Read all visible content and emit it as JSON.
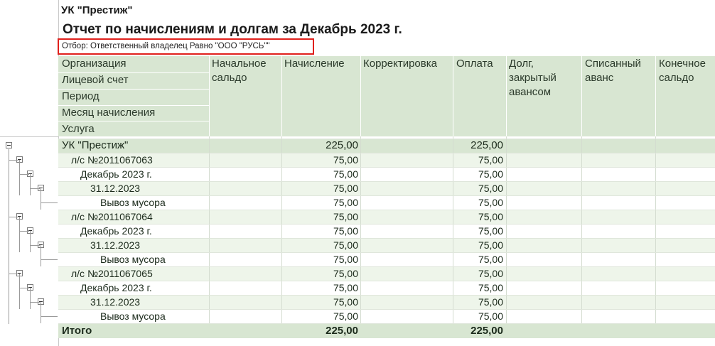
{
  "report": {
    "org": "УК \"Престиж\"",
    "title": "Отчет по начислениям и долгам за Декабрь 2023 г.",
    "filter": "Отбор: Ответственный владелец Равно \"ООО \"РУСЬ\"\""
  },
  "header": {
    "groupings": [
      "Организация",
      "Лицевой счет",
      "Период",
      "Месяц начисления",
      "Услуга"
    ],
    "columns": [
      {
        "l1": "Начальное",
        "l2": "сальдо",
        "l3": ""
      },
      {
        "l1": "Начисление",
        "l2": "",
        "l3": ""
      },
      {
        "l1": "Корректировка",
        "l2": "",
        "l3": ""
      },
      {
        "l1": "Оплата",
        "l2": "",
        "l3": ""
      },
      {
        "l1": "Долг,",
        "l2": "закрытый",
        "l3": "авансом"
      },
      {
        "l1": "Списанный",
        "l2": "аванс",
        "l3": ""
      },
      {
        "l1": "Конечное",
        "l2": "сальдо",
        "l3": ""
      }
    ]
  },
  "rows": [
    {
      "label": "УК \"Престиж\"",
      "charge": "225,00",
      "payment": "225,00"
    },
    {
      "label": "л/с №2011067063",
      "charge": "75,00",
      "payment": "75,00"
    },
    {
      "label": "Декабрь 2023  г.",
      "charge": "75,00",
      "payment": "75,00"
    },
    {
      "label": "31.12.2023",
      "charge": "75,00",
      "payment": "75,00"
    },
    {
      "label": "Вывоз мусора",
      "charge": "75,00",
      "payment": "75,00"
    },
    {
      "label": "л/с №2011067064",
      "charge": "75,00",
      "payment": "75,00"
    },
    {
      "label": "Декабрь 2023  г.",
      "charge": "75,00",
      "payment": "75,00"
    },
    {
      "label": "31.12.2023",
      "charge": "75,00",
      "payment": "75,00"
    },
    {
      "label": "Вывоз мусора",
      "charge": "75,00",
      "payment": "75,00"
    },
    {
      "label": "л/с №2011067065",
      "charge": "75,00",
      "payment": "75,00"
    },
    {
      "label": "Декабрь 2023  г.",
      "charge": "75,00",
      "payment": "75,00"
    },
    {
      "label": "31.12.2023",
      "charge": "75,00",
      "payment": "75,00"
    },
    {
      "label": "Вывоз мусора",
      "charge": "75,00",
      "payment": "75,00"
    }
  ],
  "total": {
    "label": "Итого",
    "charge": "225,00",
    "payment": "225,00"
  }
}
